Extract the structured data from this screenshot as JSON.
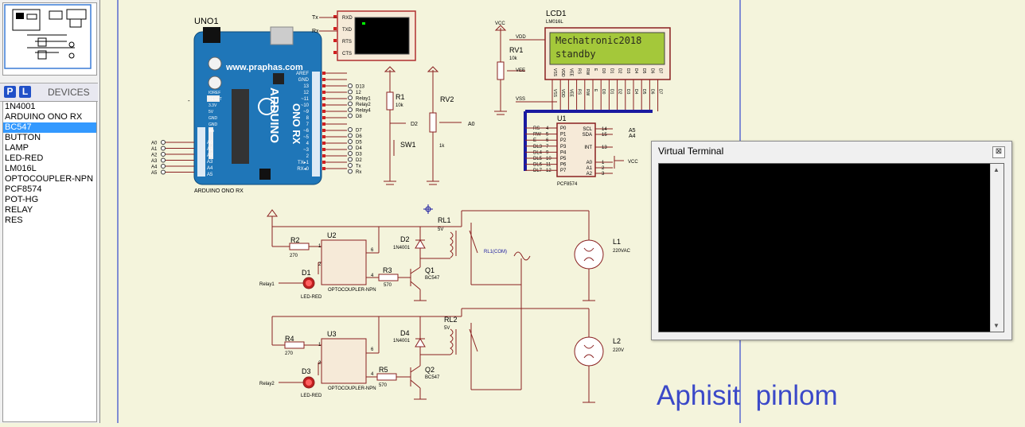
{
  "devices": {
    "title": "DEVICES",
    "btn_p": "P",
    "btn_l": "L",
    "items": [
      "1N4001",
      "ARDUINO ONO RX",
      "BC547",
      "BUTTON",
      "LAMP",
      "LED-RED",
      "LM016L",
      "OPTOCOUPLER-NPN",
      "PCF8574",
      "POT-HG",
      "RELAY",
      "RES"
    ],
    "selected": 2
  },
  "terminal": {
    "title": "Virtual Terminal",
    "close": "⊠"
  },
  "signature": "Aphisit  pinlom",
  "lcd": {
    "line1": "Mechatronic2018",
    "line2": "standby"
  },
  "labels": {
    "uno": "UNO1",
    "web": "www.praphas.com",
    "arduino": "ARDUINO",
    "uno_rx": "ONO RX",
    "uno_bottom": "ARDUINO ONO RX",
    "lcd1": "LCD1",
    "lm016l": "LM016L",
    "vcc": "VCC",
    "rv1": "RV1",
    "rv1_val": "10k",
    "rv2": "RV2",
    "rv2_val": "1k",
    "r1": "R1",
    "r1_val": "10k",
    "sw1": "SW1",
    "u1": "U1",
    "pcf": "PCF8574",
    "rl1": "RL1",
    "rl1_v": "5V",
    "rl1com": "RL1(COM)",
    "rl2": "RL2",
    "rl2_v": "5V",
    "l1": "L1",
    "l1v": "220VAC",
    "l2": "L2",
    "l2v": "220V",
    "d1": "D1",
    "d2": "D2",
    "d3": "D3",
    "d4": "D4",
    "ledred": "LED-RED",
    "diode": "1N4001",
    "u2": "U2",
    "u3": "U3",
    "opto": "OPTOCOUPLER-NPN",
    "r2": "R2",
    "r3": "R3",
    "r4": "R4",
    "r5": "R5",
    "r270": "270",
    "r570": "570",
    "q1": "Q1",
    "q2": "Q2",
    "bc547": "BC547",
    "relay1": "Relay1",
    "relay2": "Relay2",
    "tx": "Tx",
    "rx": "Rx",
    "a0": "A0",
    "a4": "A4",
    "a5": "A5"
  },
  "vterm_pins": [
    "RXD",
    "TXD",
    "RTS",
    "CTS"
  ],
  "uno_left_pins": [
    "A0",
    "A1",
    "A2",
    "A3",
    "A4",
    "A5"
  ],
  "uno_right_nets": [
    "D13",
    "12",
    "Relay1",
    "Relay2",
    "Relay4",
    "D8",
    "D7",
    "D6",
    "D5",
    "D4",
    "D3",
    "D2",
    "Tx",
    "Rx"
  ],
  "uno_right_pins": [
    "AREF",
    "GND",
    "13",
    "12",
    "~11",
    "~10",
    "~9",
    "8",
    "7",
    "~6",
    "~5",
    "4",
    "~3",
    "2",
    "TX▸1",
    "RX◂0"
  ],
  "uno_power_pins": [
    "IOREF",
    "RESET",
    "3.3V",
    "5V",
    "GND",
    "GND",
    "Vin"
  ],
  "uno_analog_pins": [
    "A0",
    "A1",
    "A2",
    "A3",
    "A4",
    "A5"
  ],
  "lcd_pins": [
    "VSS",
    "VDD",
    "VEE",
    "RS",
    "RW",
    "E",
    "D0",
    "D1",
    "D2",
    "D3",
    "D4",
    "D5",
    "D6",
    "D7"
  ],
  "pcf_left_nets": [
    "RS",
    "RW",
    "E",
    "DL3",
    "DL4",
    "DL5",
    "DL6",
    "DL7"
  ],
  "pcf_left_pins": [
    "P0",
    "P1",
    "P2",
    "P3",
    "P4",
    "P5",
    "P6",
    "P7"
  ],
  "pcf_pin_nums": [
    "4",
    "5",
    "6",
    "7",
    "9",
    "10",
    "11",
    "12"
  ],
  "pcf_right_pins": [
    "SCL",
    "SDA",
    "INT",
    "A0",
    "A1",
    "A2"
  ],
  "pcf_right_nums": [
    "14",
    "15",
    "13",
    "1",
    "2",
    "3"
  ]
}
